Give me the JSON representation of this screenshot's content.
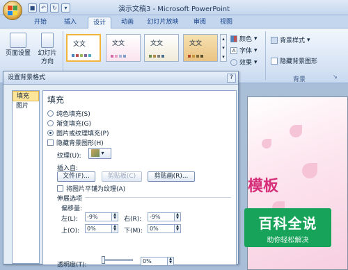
{
  "titlebar": {
    "title": "演示文稿3 - Microsoft PowerPoint",
    "undo": "↶",
    "redo": "↻"
  },
  "tabs": [
    "开始",
    "插入",
    "设计",
    "动画",
    "幻灯片放映",
    "审阅",
    "视图"
  ],
  "active_tab": "设计",
  "ribbon": {
    "page_setup": "页面设置",
    "slide_orientation_1": "幻灯片",
    "slide_orientation_2": "方向",
    "themes": [
      "文文",
      "文文",
      "文文",
      "文文"
    ],
    "colors": "颜色",
    "fonts": "字体",
    "effects": "效果",
    "background_styles": "背景样式",
    "hide_background": "隐藏背景图形",
    "group_background": "背景"
  },
  "dialog": {
    "title": "设置背景格式",
    "close": "?",
    "nav": [
      "填充",
      "图片"
    ],
    "section_title": "填充",
    "fill_options": [
      "纯色填充(S)",
      "渐变填充(G)",
      "图片或纹理填充(P)"
    ],
    "selected_fill": 2,
    "hide_bg": "隐藏背景图形(H)",
    "texture_label": "纹理(U):",
    "insert_from": "插入自:",
    "btn_file": "文件(F)...",
    "btn_clipboard": "剪贴板(C)",
    "btn_clipart": "剪贴画(R)...",
    "tile_label": "将图片平铺为纹理(A)",
    "stretch_label": "伸展选项",
    "offset_label": "偏移量:",
    "left_label": "左(L):",
    "left_value": "-9%",
    "right_label": "右(R):",
    "right_value": "-9%",
    "top_label": "上(O):",
    "top_value": "0%",
    "bottom_label": "下(M):",
    "bottom_value": "0%",
    "transparency_label": "透明度(T):",
    "transparency_value": "0%"
  },
  "slide": {
    "title": "模板"
  },
  "watermark": {
    "main": "百科全说",
    "sub": "助你轻松解决"
  }
}
